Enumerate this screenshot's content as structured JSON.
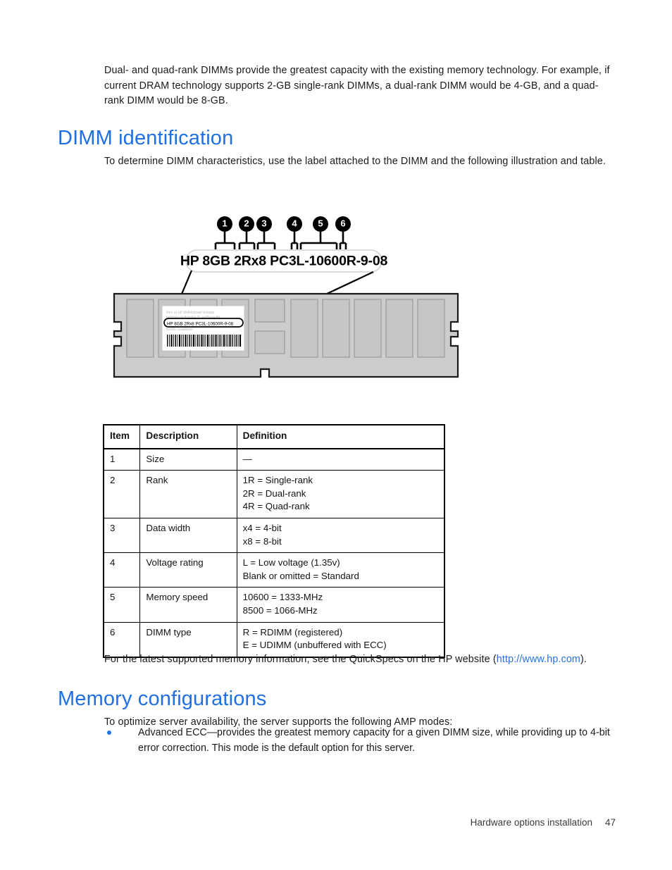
{
  "intro_paragraph": "Dual- and quad-rank DIMMs provide the greatest capacity with the existing memory technology. For example, if current DRAM technology supports 2-GB single-rank DIMMs, a dual-rank DIMM would be 4-GB, and a quad-rank DIMM would be 8-GB.",
  "sections": {
    "dimm_identification": {
      "heading": "DIMM identification",
      "paragraph": "To determine DIMM characteristics, use the label attached to the DIMM and the following illustration and table.",
      "after_table_text_before_link": "For the latest supported memory information, see the QuickSpecs on the HP website (",
      "after_table_link": "http://www.hp.com",
      "after_table_text_after_link": ")."
    },
    "memory_configurations": {
      "heading": "Memory configurations",
      "paragraph": "To optimize server availability, the server supports the following AMP modes:",
      "bullets": [
        "Advanced ECC—provides the greatest memory capacity for a given DIMM size, while providing up to 4-bit error correction.   This mode is the default option for this server."
      ]
    }
  },
  "figure": {
    "label_text": "HP 8GB 2Rx8 PC3L-10600R-9-08",
    "callout_numbers": [
      "1",
      "2",
      "3",
      "4",
      "5",
      "6"
    ],
    "sticker_label_text": "HP 8GB 2Rx8 PC3L-10600R-9-08",
    "sticker_faint_lines": [
      "Rev xx jdl  dsdklsbsad snaaas",
      "bdddslesijsfbdsfsb lS swfBsasdfd",
      "bsebb csaabban"
    ]
  },
  "table": {
    "headers": [
      "Item",
      "Description",
      "Definition"
    ],
    "rows": [
      {
        "item": "1",
        "description": "Size",
        "definition": [
          "—"
        ]
      },
      {
        "item": "2",
        "description": "Rank",
        "definition": [
          "1R = Single-rank",
          "2R = Dual-rank",
          "4R = Quad-rank"
        ]
      },
      {
        "item": "3",
        "description": "Data width",
        "definition": [
          "x4 = 4-bit",
          "x8 = 8-bit"
        ]
      },
      {
        "item": "4",
        "description": "Voltage rating",
        "definition": [
          "L = Low voltage (1.35v)",
          "Blank or omitted = Standard"
        ]
      },
      {
        "item": "5",
        "description": "Memory speed",
        "definition": [
          "10600 = 1333-MHz",
          "8500 = 1066-MHz"
        ]
      },
      {
        "item": "6",
        "description": "DIMM type",
        "definition": [
          "R = RDIMM (registered)",
          "E = UDIMM (unbuffered with ECC)"
        ]
      }
    ]
  },
  "footer": {
    "chapter": "Hardware options installation",
    "page_number": "47"
  },
  "colors": {
    "heading_blue": "#1f6fe5",
    "link_blue": "#2272e8",
    "bullet_blue": "#2272e8",
    "dimm_body": "#c9c9c9",
    "dimm_chip": "#c0c0c0",
    "sticker": "#ffffff"
  }
}
